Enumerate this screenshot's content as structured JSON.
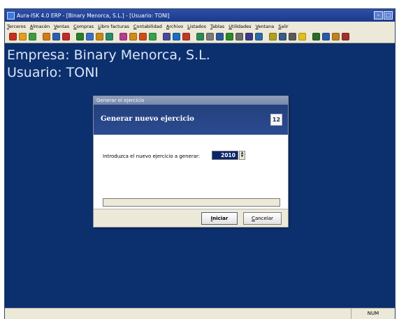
{
  "window": {
    "title": "Aura-ISK 4.0 ERP - [Binary Menorca, S.L.] - [Usuario: TONI]"
  },
  "menu": [
    "Terceros",
    "Almacén",
    "Ventas",
    "Compras",
    "Libro facturas",
    "Contabilidad",
    "Archivo",
    "Listados",
    "Tablas",
    "Utilidades",
    "Ventana",
    "Salir"
  ],
  "toolbar": {
    "icons": [
      "user-icon",
      "user2-icon",
      "chart-icon",
      "heart-icon",
      "doc1-icon",
      "doc2-icon",
      "doc3-icon",
      "book1-icon",
      "book2-icon",
      "book3-icon",
      "gift-icon",
      "truck-icon",
      "pencil-icon",
      "magic-icon",
      "calc-icon",
      "doc4-icon",
      "doc5-icon",
      "doc6-icon",
      "arrow-icon",
      "monitor-icon",
      "chart2-icon",
      "grid-icon",
      "list-icon",
      "window-icon",
      "refresh-icon",
      "tile-icon",
      "print-icon",
      "lightning-icon",
      "sheet1-icon",
      "sheet2-icon",
      "help-icon",
      "exit-icon"
    ],
    "colors": [
      "#c7301c",
      "#e0a020",
      "#3e9c3e",
      "#d27a1d",
      "#2b5fb3",
      "#c22a2a",
      "#2a7f2a",
      "#3a6fc4",
      "#c68a16",
      "#2a8a6a",
      "#b63b8f",
      "#d28a1a",
      "#d24a1a",
      "#3aa04a",
      "#4a4a9a",
      "#1b6fc0",
      "#c0392b",
      "#2c8a5a",
      "#7a7a7a",
      "#2a5a9a",
      "#2a8a2a",
      "#6a6a6a",
      "#3a3a8a",
      "#2a6aaa",
      "#b0a020",
      "#3a5a8a",
      "#5a5a5a",
      "#e0c020",
      "#2a6a2a",
      "#2a5aaa",
      "#c08020",
      "#a03030"
    ]
  },
  "desktop": {
    "line1": "Empresa: Binary Menorca, S.L.",
    "line2": "Usuario: TONI"
  },
  "status": {
    "num": "NUM"
  },
  "dialog": {
    "title": "Generar el ejercicio",
    "heading": "Generar nuevo ejercicio",
    "icon_text": "12",
    "prompt": "Introduzca el nuevo ejercicio a generar:",
    "year": "2010",
    "progress": 0,
    "start_label": "Iniciar",
    "cancel_label": "Cancelar"
  }
}
